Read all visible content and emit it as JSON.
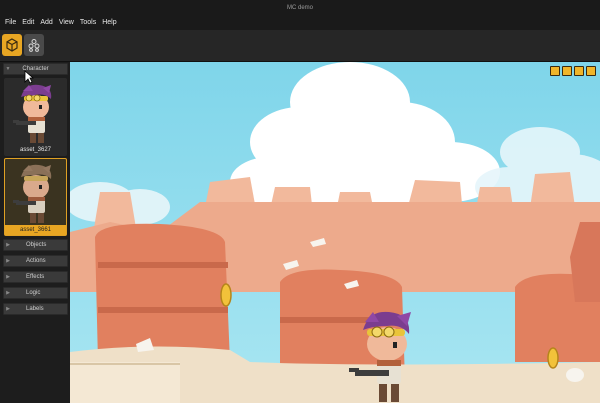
{
  "window": {
    "title": "MC demo"
  },
  "menu": {
    "items": [
      "File",
      "Edit",
      "Add",
      "View",
      "Tools",
      "Help"
    ]
  },
  "toolbar": {
    "buttons": [
      {
        "icon": "cube-icon",
        "active": true
      },
      {
        "icon": "stack-icon",
        "active": false
      }
    ]
  },
  "sidebar": {
    "sections": {
      "character": "Character",
      "objects": "Objects",
      "actions": "Actions",
      "effects": "Effects",
      "logic": "Logic",
      "labels": "Labels"
    },
    "assets": [
      {
        "name": "asset_3627",
        "selected": false
      },
      {
        "name": "asset_3661",
        "selected": true
      }
    ]
  },
  "viewport": {
    "controls": [
      "lock-icon",
      "rotate-icon",
      "edit-icon",
      "delete-icon"
    ]
  },
  "colors": {
    "accent": "#e8a623",
    "sky": "#8fdcef",
    "rock": "#e8876a",
    "sand": "#efe0c8"
  }
}
